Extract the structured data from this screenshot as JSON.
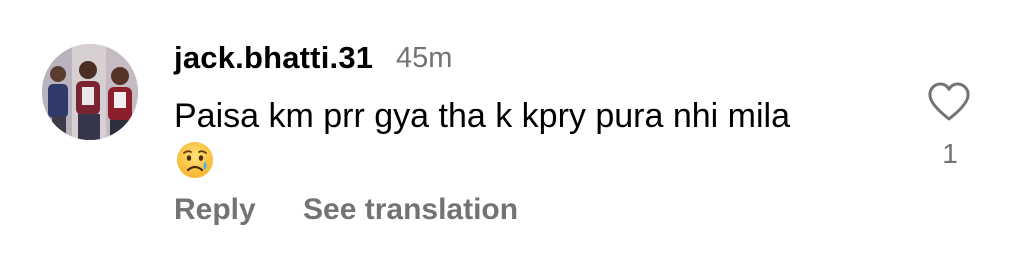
{
  "comment": {
    "username": "jack.bhatti.31",
    "timestamp": "45m",
    "text": "Paisa km prr gya tha k kpry pura nhi mila",
    "emoji": "crying-face",
    "like_count": "1",
    "actions": {
      "reply_label": "Reply",
      "translation_label": "See translation"
    }
  },
  "colors": {
    "primary_text": "#000000",
    "secondary_text": "#737373",
    "background": "#ffffff"
  },
  "icons": {
    "like": "heart-outline-icon"
  }
}
